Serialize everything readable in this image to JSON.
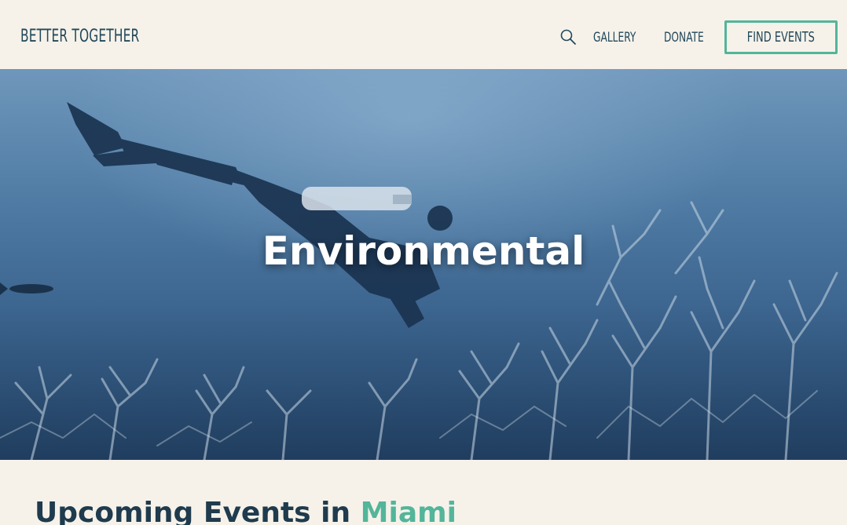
{
  "header": {
    "logo_text": "BETTER TOGETHER",
    "search_icon": "search-icon",
    "nav": [
      {
        "label": "GALLERY"
      },
      {
        "label": "DONATE"
      }
    ],
    "cta_label": "FIND EVENTS"
  },
  "hero": {
    "title": "Environmental"
  },
  "events": {
    "heading_prefix": "Upcoming Events in",
    "city": "Miami"
  },
  "colors": {
    "background": "#f6f2ea",
    "text_dark": "#1f3b4d",
    "accent_green": "#53b59a",
    "hero_blue": "#4e7aa3"
  }
}
